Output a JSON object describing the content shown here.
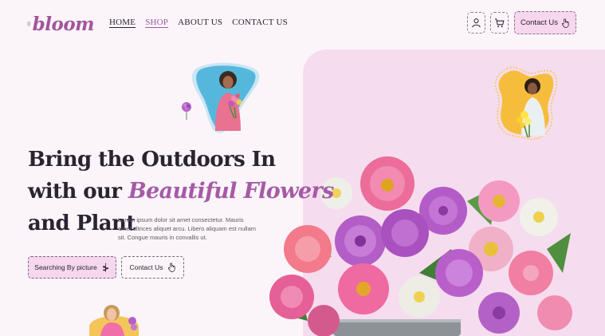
{
  "brand": {
    "name": "bloom",
    "accent": "#a2559a"
  },
  "nav": {
    "items": [
      {
        "label": "HOME"
      },
      {
        "label": "SHOP"
      },
      {
        "label": "ABOUT US"
      },
      {
        "label": "CONTACT US"
      }
    ]
  },
  "header": {
    "account_icon": "user-icon",
    "cart_icon": "cart-icon",
    "contact_label": "Contact Us"
  },
  "hero": {
    "line1": "Bring the Outdoors In",
    "line2_prefix": "with our",
    "line2_accent": "Beautiful Flowers",
    "line3": "and Plant",
    "description": "Lorem ipsum dolor sit amet consectetur. Mauris amet ultrices aliquet arcu. Libero aliquam est nullam sit. Congue mauris in convallis ut.",
    "search_label": "Searching By picture",
    "contact_label": "Contact Us"
  },
  "colors": {
    "background": "#fbf5fa",
    "panel": "#f6dcef",
    "button_pink": "#f6d7ee",
    "accent_purple": "#a55aa6"
  }
}
